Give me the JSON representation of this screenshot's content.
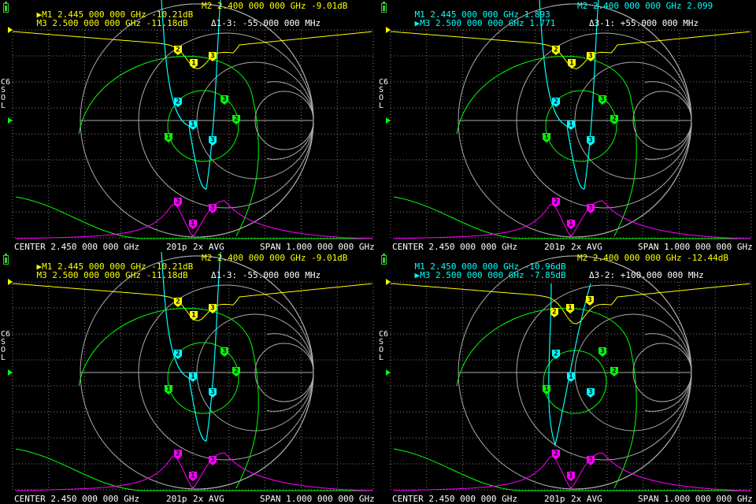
{
  "colors": {
    "background": "#000000",
    "grid": "#808080",
    "text": "#ffffff",
    "trace_s11_logmag": "#ffff00",
    "trace_smith": "#00ffff",
    "trace_phase": "#00ff00",
    "trace_s21": "#ff00ff",
    "battery": "#33cc33"
  },
  "panels": [
    {
      "id": "top-left",
      "marker_lines": [
        {
          "prefix": "▶M1",
          "text": "2.445 000 000 GHz",
          "value": "-10.21dB",
          "color": "yellow"
        },
        {
          "prefix": "M3",
          "text": "2.500 000 000 GHz",
          "value": "-11.18dB",
          "color": "yellow"
        }
      ],
      "right_marker": {
        "label": "M2 2.400 000 000 GHz -9.01dB"
      },
      "delta": "Δ1-3: -55.000 000 MHz",
      "side_label": [
        "C6",
        "S",
        "O",
        "L"
      ],
      "footer": {
        "center": "CENTER 2.450 000 000 GHz",
        "points": "201p",
        "avg": "2x AVG",
        "span": "SPAN 1.000 000 000 GHz"
      }
    },
    {
      "id": "top-right",
      "marker_lines": [
        {
          "prefix": "M1",
          "text": "2.445 000 000 GHz",
          "value": "1.893",
          "color": "cyan"
        },
        {
          "prefix": "▶M3",
          "text": "2.500 000 000 GHz",
          "value": "1.771",
          "color": "cyan"
        }
      ],
      "right_marker": {
        "label": "M2 2.400 000 000 GHz 2.099"
      },
      "delta": "Δ3-1: +55.000 000 MHz",
      "side_label": [
        "C6",
        "S",
        "O",
        "L"
      ],
      "footer": {
        "center": "CENTER 2.450 000 000 GHz",
        "points": "201p",
        "avg": "2x AVG",
        "span": "SPAN 1.000 000 000 GHz"
      }
    },
    {
      "id": "bottom-left",
      "marker_lines": [
        {
          "prefix": "▶M1",
          "text": "2.445 000 000 GHz",
          "value": "-10.21dB",
          "color": "yellow"
        },
        {
          "prefix": "M3",
          "text": "2.500 000 000 GHz",
          "value": "-11.18dB",
          "color": "yellow"
        }
      ],
      "right_marker": {
        "label": "M2 2.400 000 000 GHz -9.01dB"
      },
      "delta": "Δ1-3: -55.000 000 MHz",
      "side_label": [
        "C6",
        "S",
        "O",
        "L"
      ],
      "footer": {
        "center": "CENTER 2.450 000 000 GHz",
        "points": "201p",
        "avg": "2x AVG",
        "span": "SPAN 1.000 000 000 GHz"
      }
    },
    {
      "id": "bottom-right",
      "marker_lines": [
        {
          "prefix": "M1",
          "text": "2.450 000 000 GHz",
          "value": "-10.96dB",
          "color": "yellow"
        },
        {
          "prefix": "▶M3",
          "text": "2.500 000 000 GHz",
          "value": "-7.85dB",
          "color": "yellow"
        }
      ],
      "right_marker": {
        "label": "M2 2.400 000 000 GHz -12.44dB"
      },
      "delta": "Δ3-2: +100.000 000 MHz",
      "side_label": [
        "C6",
        "S",
        "O",
        "L"
      ],
      "footer": {
        "center": "CENTER 2.450 000 000 GHz",
        "points": "201p",
        "avg": "2x AVG",
        "span": "SPAN 1.000 000 000 GHz"
      }
    }
  ]
}
